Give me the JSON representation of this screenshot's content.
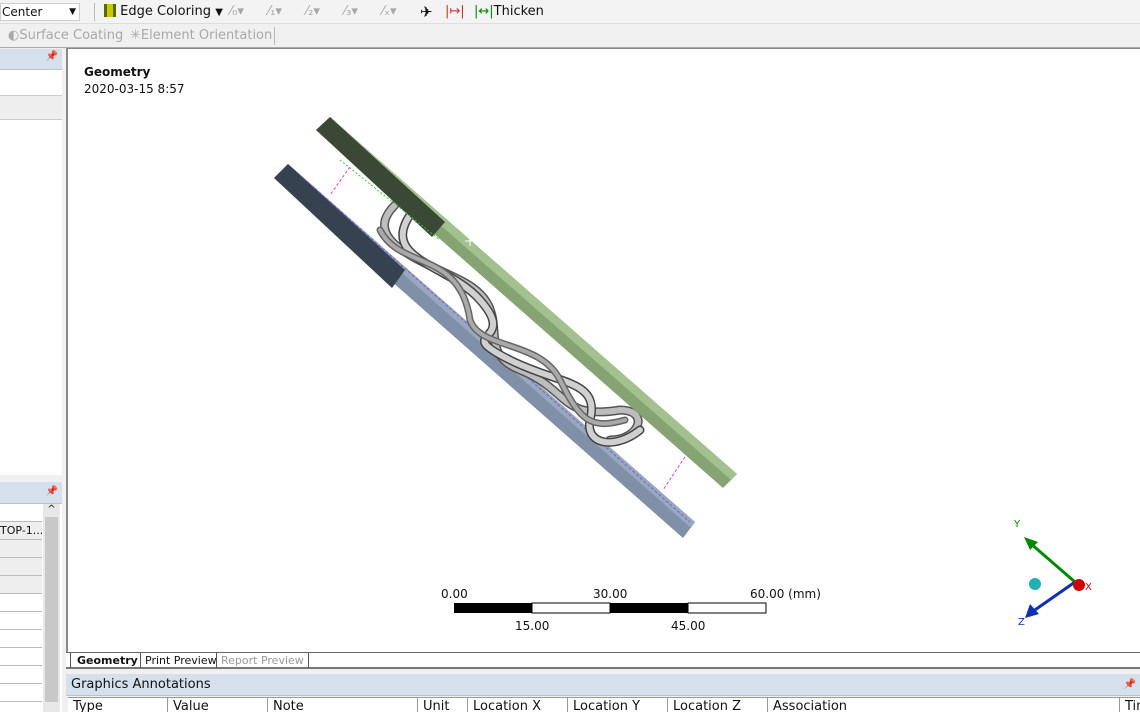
{
  "toolbar": {
    "view_combo": "Center",
    "edge_coloring": "Edge Coloring",
    "thicken": "Thicken",
    "surface_coating": "Surface Coating",
    "element_orientation": "Element Orientation",
    "edge_coloring_color": "#c8c800"
  },
  "viewport": {
    "title": "Geometry",
    "timestamp": "2020-03-15 8:57"
  },
  "scale_bar": {
    "top_labels": [
      "0.00",
      "30.00",
      "60.00 (mm)"
    ],
    "bottom_labels": [
      "15.00",
      "45.00"
    ]
  },
  "triad": {
    "x": "X",
    "y": "Y",
    "z": "Z"
  },
  "tabs": [
    {
      "label": "Geometry"
    },
    {
      "label": "Print Preview"
    },
    {
      "label": "Report Preview"
    }
  ],
  "left_panel": {
    "row_text": "TOP-1..."
  },
  "annotations": {
    "title": "Graphics Annotations",
    "columns": [
      "Type",
      "Value",
      "Note",
      "Unit",
      "Location X",
      "Location Y",
      "Location Z",
      "Association",
      "Tim"
    ]
  }
}
